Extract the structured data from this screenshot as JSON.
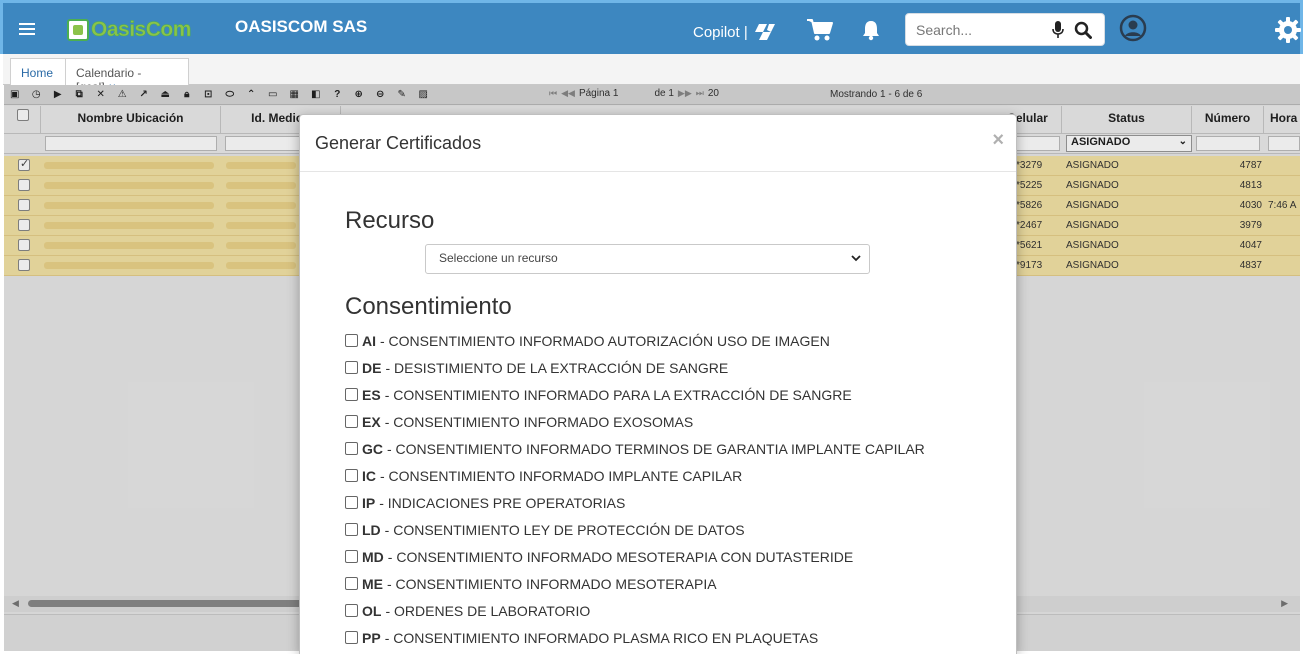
{
  "header": {
    "company": "OASISCOM SAS",
    "logo_text": "OasisCom",
    "copilot_label": "Copilot |",
    "search_placeholder": "Search..."
  },
  "tabs": [
    {
      "label": "Home"
    },
    {
      "label": "Calendario -[gcal]",
      "close": "×"
    }
  ],
  "grid": {
    "pager": {
      "page_label": "Página 1",
      "of_label": "de 1",
      "page_size": "20",
      "records": "Mostrando 1 - 6 de 6"
    },
    "columns": {
      "location": "Nombre Ubicación",
      "doctor_id": "Id. Medico",
      "phone": "Celular",
      "status": "Status",
      "number": "Número",
      "time": "Hora"
    },
    "status_filter": "ASIGNADO",
    "rows": [
      {
        "checked": true,
        "phone": "*3279",
        "status": "ASIGNADO",
        "number": "4787",
        "time": ""
      },
      {
        "checked": false,
        "phone": "*5225",
        "status": "ASIGNADO",
        "number": "4813",
        "time": ""
      },
      {
        "checked": false,
        "phone": "*5826",
        "status": "ASIGNADO",
        "number": "4030",
        "time": "7:46 A"
      },
      {
        "checked": false,
        "phone": "*2467",
        "status": "ASIGNADO",
        "number": "3979",
        "time": ""
      },
      {
        "checked": false,
        "phone": "*5621",
        "status": "ASIGNADO",
        "number": "4047",
        "time": ""
      },
      {
        "checked": false,
        "phone": "*9173",
        "status": "ASIGNADO",
        "number": "4837",
        "time": ""
      }
    ]
  },
  "modal": {
    "title": "Generar Certificados",
    "close": "×",
    "resource_title": "Recurso",
    "resource_placeholder": "Seleccione un recurso",
    "consent_title": "Consentimiento",
    "consents": [
      {
        "code": "AI",
        "desc": "- CONSENTIMIENTO INFORMADO AUTORIZACIÓN USO DE IMAGEN"
      },
      {
        "code": "DE",
        "desc": "- DESISTIMIENTO DE LA EXTRACCIÓN DE SANGRE"
      },
      {
        "code": "ES",
        "desc": "- CONSENTIMIENTO INFORMADO PARA LA EXTRACCIÓN DE SANGRE"
      },
      {
        "code": "EX",
        "desc": "- CONSENTIMIENTO INFORMADO EXOSOMAS"
      },
      {
        "code": "GC",
        "desc": "- CONSENTIMIENTO INFORMADO TERMINOS DE GARANTIA IMPLANTE CAPILAR"
      },
      {
        "code": "IC",
        "desc": "- CONSENTIMIENTO INFORMADO IMPLANTE CAPILAR"
      },
      {
        "code": "IP",
        "desc": "- INDICACIONES PRE OPERATORIAS"
      },
      {
        "code": "LD",
        "desc": "- CONSENTIMIENTO LEY DE PROTECCIÓN DE DATOS"
      },
      {
        "code": "MD",
        "desc": "- CONSENTIMIENTO INFORMADO MESOTERAPIA CON DUTASTERIDE"
      },
      {
        "code": "ME",
        "desc": "- CONSENTIMIENTO INFORMADO MESOTERAPIA"
      },
      {
        "code": "OL",
        "desc": "- ORDENES DE LABORATORIO"
      },
      {
        "code": "PP",
        "desc": "- CONSENTIMIENTO INFORMADO PLASMA RICO EN PLAQUETAS"
      }
    ]
  },
  "colors": {
    "header_bg": "#3d87c0",
    "row_highlight": "#f5e4a6",
    "logo_green": "#8bc34a"
  }
}
